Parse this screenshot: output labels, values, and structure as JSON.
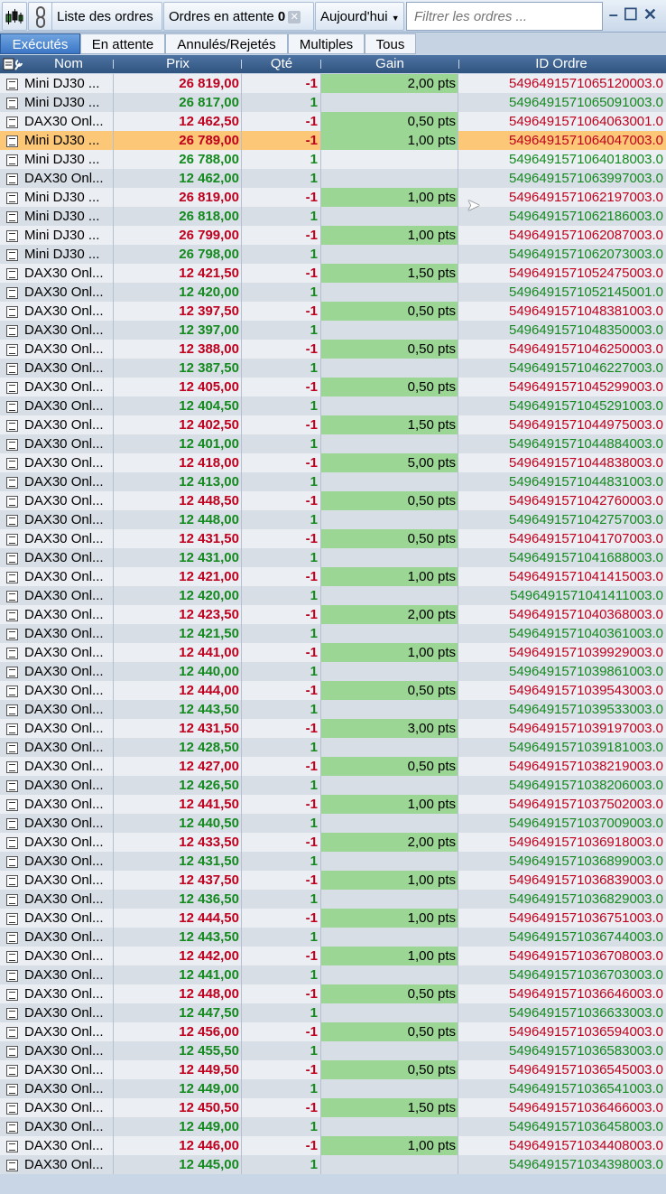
{
  "toolbar": {
    "list_label": "Liste des ordres",
    "pending_label": "Ordres en attente",
    "pending_count": "0",
    "date_filter": "Aujourd'hui",
    "filter_placeholder": "Filtrer les ordres ..."
  },
  "tabs": [
    "Exécutés",
    "En attente",
    "Annulés/Rejetés",
    "Multiples",
    "Tous"
  ],
  "columns": {
    "nom": "Nom",
    "prix": "Prix",
    "qte": "Qté",
    "gain": "Gain",
    "id": "ID Ordre"
  },
  "colors": {
    "sell": "#c0001e",
    "buy": "#138a1e",
    "gain_bg": "#9bd695",
    "selected_row": "#fcc776"
  },
  "rows": [
    {
      "nom": "Mini DJ30 ...",
      "prix": "26 819,00",
      "qte": "-1",
      "gain": "2,00 pts",
      "id": "5496491571065120003.0"
    },
    {
      "nom": "Mini DJ30 ...",
      "prix": "26 817,00",
      "qte": "1",
      "gain": "",
      "id": "5496491571065091003.0"
    },
    {
      "nom": "DAX30 Onl...",
      "prix": "12 462,50",
      "qte": "-1",
      "gain": "0,50 pts",
      "id": "5496491571064063001.0"
    },
    {
      "nom": "Mini DJ30 ...",
      "prix": "26 789,00",
      "qte": "-1",
      "gain": "1,00 pts",
      "id": "5496491571064047003.0",
      "selected": true
    },
    {
      "nom": "Mini DJ30 ...",
      "prix": "26 788,00",
      "qte": "1",
      "gain": "",
      "id": "5496491571064018003.0"
    },
    {
      "nom": "DAX30 Onl...",
      "prix": "12 462,00",
      "qte": "1",
      "gain": "",
      "id": "5496491571063997003.0"
    },
    {
      "nom": "Mini DJ30 ...",
      "prix": "26 819,00",
      "qte": "-1",
      "gain": "1,00 pts",
      "id": "5496491571062197003.0"
    },
    {
      "nom": "Mini DJ30 ...",
      "prix": "26 818,00",
      "qte": "1",
      "gain": "",
      "id": "5496491571062186003.0"
    },
    {
      "nom": "Mini DJ30 ...",
      "prix": "26 799,00",
      "qte": "-1",
      "gain": "1,00 pts",
      "id": "5496491571062087003.0"
    },
    {
      "nom": "Mini DJ30 ...",
      "prix": "26 798,00",
      "qte": "1",
      "gain": "",
      "id": "5496491571062073003.0"
    },
    {
      "nom": "DAX30 Onl...",
      "prix": "12 421,50",
      "qte": "-1",
      "gain": "1,50 pts",
      "id": "5496491571052475003.0"
    },
    {
      "nom": "DAX30 Onl...",
      "prix": "12 420,00",
      "qte": "1",
      "gain": "",
      "id": "5496491571052145001.0"
    },
    {
      "nom": "DAX30 Onl...",
      "prix": "12 397,50",
      "qte": "-1",
      "gain": "0,50 pts",
      "id": "5496491571048381003.0"
    },
    {
      "nom": "DAX30 Onl...",
      "prix": "12 397,00",
      "qte": "1",
      "gain": "",
      "id": "5496491571048350003.0"
    },
    {
      "nom": "DAX30 Onl...",
      "prix": "12 388,00",
      "qte": "-1",
      "gain": "0,50 pts",
      "id": "5496491571046250003.0"
    },
    {
      "nom": "DAX30 Onl...",
      "prix": "12 387,50",
      "qte": "1",
      "gain": "",
      "id": "5496491571046227003.0"
    },
    {
      "nom": "DAX30 Onl...",
      "prix": "12 405,00",
      "qte": "-1",
      "gain": "0,50 pts",
      "id": "5496491571045299003.0"
    },
    {
      "nom": "DAX30 Onl...",
      "prix": "12 404,50",
      "qte": "1",
      "gain": "",
      "id": "5496491571045291003.0"
    },
    {
      "nom": "DAX30 Onl...",
      "prix": "12 402,50",
      "qte": "-1",
      "gain": "1,50 pts",
      "id": "5496491571044975003.0"
    },
    {
      "nom": "DAX30 Onl...",
      "prix": "12 401,00",
      "qte": "1",
      "gain": "",
      "id": "5496491571044884003.0"
    },
    {
      "nom": "DAX30 Onl...",
      "prix": "12 418,00",
      "qte": "-1",
      "gain": "5,00 pts",
      "id": "5496491571044838003.0"
    },
    {
      "nom": "DAX30 Onl...",
      "prix": "12 413,00",
      "qte": "1",
      "gain": "",
      "id": "5496491571044831003.0"
    },
    {
      "nom": "DAX30 Onl...",
      "prix": "12 448,50",
      "qte": "-1",
      "gain": "0,50 pts",
      "id": "5496491571042760003.0"
    },
    {
      "nom": "DAX30 Onl...",
      "prix": "12 448,00",
      "qte": "1",
      "gain": "",
      "id": "5496491571042757003.0"
    },
    {
      "nom": "DAX30 Onl...",
      "prix": "12 431,50",
      "qte": "-1",
      "gain": "0,50 pts",
      "id": "5496491571041707003.0"
    },
    {
      "nom": "DAX30 Onl...",
      "prix": "12 431,00",
      "qte": "1",
      "gain": "",
      "id": "5496491571041688003.0"
    },
    {
      "nom": "DAX30 Onl...",
      "prix": "12 421,00",
      "qte": "-1",
      "gain": "1,00 pts",
      "id": "5496491571041415003.0"
    },
    {
      "nom": "DAX30 Onl...",
      "prix": "12 420,00",
      "qte": "1",
      "gain": "",
      "id": "5496491571041411003.0"
    },
    {
      "nom": "DAX30 Onl...",
      "prix": "12 423,50",
      "qte": "-1",
      "gain": "2,00 pts",
      "id": "5496491571040368003.0"
    },
    {
      "nom": "DAX30 Onl...",
      "prix": "12 421,50",
      "qte": "1",
      "gain": "",
      "id": "5496491571040361003.0"
    },
    {
      "nom": "DAX30 Onl...",
      "prix": "12 441,00",
      "qte": "-1",
      "gain": "1,00 pts",
      "id": "5496491571039929003.0"
    },
    {
      "nom": "DAX30 Onl...",
      "prix": "12 440,00",
      "qte": "1",
      "gain": "",
      "id": "5496491571039861003.0"
    },
    {
      "nom": "DAX30 Onl...",
      "prix": "12 444,00",
      "qte": "-1",
      "gain": "0,50 pts",
      "id": "5496491571039543003.0"
    },
    {
      "nom": "DAX30 Onl...",
      "prix": "12 443,50",
      "qte": "1",
      "gain": "",
      "id": "5496491571039533003.0"
    },
    {
      "nom": "DAX30 Onl...",
      "prix": "12 431,50",
      "qte": "-1",
      "gain": "3,00 pts",
      "id": "5496491571039197003.0"
    },
    {
      "nom": "DAX30 Onl...",
      "prix": "12 428,50",
      "qte": "1",
      "gain": "",
      "id": "5496491571039181003.0"
    },
    {
      "nom": "DAX30 Onl...",
      "prix": "12 427,00",
      "qte": "-1",
      "gain": "0,50 pts",
      "id": "5496491571038219003.0"
    },
    {
      "nom": "DAX30 Onl...",
      "prix": "12 426,50",
      "qte": "1",
      "gain": "",
      "id": "5496491571038206003.0"
    },
    {
      "nom": "DAX30 Onl...",
      "prix": "12 441,50",
      "qte": "-1",
      "gain": "1,00 pts",
      "id": "5496491571037502003.0"
    },
    {
      "nom": "DAX30 Onl...",
      "prix": "12 440,50",
      "qte": "1",
      "gain": "",
      "id": "5496491571037009003.0"
    },
    {
      "nom": "DAX30 Onl...",
      "prix": "12 433,50",
      "qte": "-1",
      "gain": "2,00 pts",
      "id": "5496491571036918003.0"
    },
    {
      "nom": "DAX30 Onl...",
      "prix": "12 431,50",
      "qte": "1",
      "gain": "",
      "id": "5496491571036899003.0"
    },
    {
      "nom": "DAX30 Onl...",
      "prix": "12 437,50",
      "qte": "-1",
      "gain": "1,00 pts",
      "id": "5496491571036839003.0"
    },
    {
      "nom": "DAX30 Onl...",
      "prix": "12 436,50",
      "qte": "1",
      "gain": "",
      "id": "5496491571036829003.0"
    },
    {
      "nom": "DAX30 Onl...",
      "prix": "12 444,50",
      "qte": "-1",
      "gain": "1,00 pts",
      "id": "5496491571036751003.0"
    },
    {
      "nom": "DAX30 Onl...",
      "prix": "12 443,50",
      "qte": "1",
      "gain": "",
      "id": "5496491571036744003.0"
    },
    {
      "nom": "DAX30 Onl...",
      "prix": "12 442,00",
      "qte": "-1",
      "gain": "1,00 pts",
      "id": "5496491571036708003.0"
    },
    {
      "nom": "DAX30 Onl...",
      "prix": "12 441,00",
      "qte": "1",
      "gain": "",
      "id": "5496491571036703003.0"
    },
    {
      "nom": "DAX30 Onl...",
      "prix": "12 448,00",
      "qte": "-1",
      "gain": "0,50 pts",
      "id": "5496491571036646003.0"
    },
    {
      "nom": "DAX30 Onl...",
      "prix": "12 447,50",
      "qte": "1",
      "gain": "",
      "id": "5496491571036633003.0"
    },
    {
      "nom": "DAX30 Onl...",
      "prix": "12 456,00",
      "qte": "-1",
      "gain": "0,50 pts",
      "id": "5496491571036594003.0"
    },
    {
      "nom": "DAX30 Onl...",
      "prix": "12 455,50",
      "qte": "1",
      "gain": "",
      "id": "5496491571036583003.0"
    },
    {
      "nom": "DAX30 Onl...",
      "prix": "12 449,50",
      "qte": "-1",
      "gain": "0,50 pts",
      "id": "5496491571036545003.0"
    },
    {
      "nom": "DAX30 Onl...",
      "prix": "12 449,00",
      "qte": "1",
      "gain": "",
      "id": "5496491571036541003.0"
    },
    {
      "nom": "DAX30 Onl...",
      "prix": "12 450,50",
      "qte": "-1",
      "gain": "1,50 pts",
      "id": "5496491571036466003.0"
    },
    {
      "nom": "DAX30 Onl...",
      "prix": "12 449,00",
      "qte": "1",
      "gain": "",
      "id": "5496491571036458003.0"
    },
    {
      "nom": "DAX30 Onl...",
      "prix": "12 446,00",
      "qte": "-1",
      "gain": "1,00 pts",
      "id": "5496491571034408003.0"
    },
    {
      "nom": "DAX30 Onl...",
      "prix": "12 445,00",
      "qte": "1",
      "gain": "",
      "id": "5496491571034398003.0"
    }
  ]
}
